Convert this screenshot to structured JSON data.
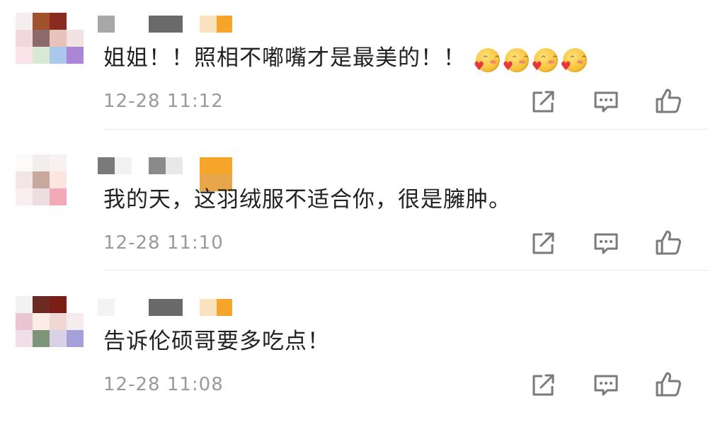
{
  "comments": [
    {
      "text": "姐姐！！照相不嘟嘴才是最美的！！",
      "emoji_count": 4,
      "emoji_name": "smitten-kiss-emoji",
      "time": "12-28 11:12"
    },
    {
      "text": "我的天，这羽绒服不适合你，很是臃肿。",
      "time": "12-28 11:10"
    },
    {
      "text": "告诉伦硕哥要多吃点！",
      "time": "12-28 11:08"
    }
  ],
  "actions": {
    "share_icon": "share-icon",
    "reply_icon": "comment-icon",
    "like_icon": "thumbs-up-icon"
  },
  "colors": {
    "text": "#222222",
    "timestamp": "#9a9a9a",
    "icon": "#7a7a7a",
    "divider": "#e6e6e6",
    "badge_orange": "#f5a52a"
  }
}
